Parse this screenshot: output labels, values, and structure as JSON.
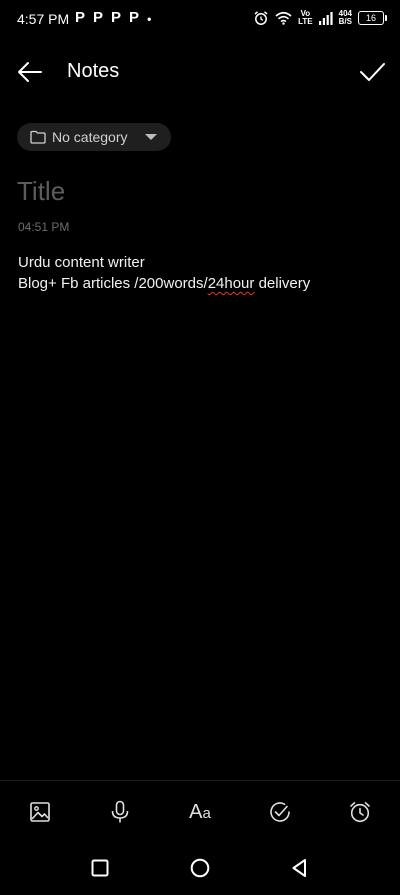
{
  "status_bar": {
    "time": "4:57 PM",
    "notifications": [
      "P",
      "P",
      "P",
      "P"
    ],
    "dot": "•",
    "network_speed_value": "404",
    "network_speed_unit": "B/S",
    "volte_top": "Vo",
    "volte_bottom": "LTE",
    "battery": "16",
    "icons": [
      "alarm-icon",
      "wifi-icon",
      "volte-icon",
      "signal-icon",
      "battery-icon"
    ]
  },
  "header": {
    "title": "Notes",
    "back_icon": "arrow-left-icon",
    "save_icon": "checkmark-icon"
  },
  "category": {
    "label": "No category",
    "icon": "folder-icon"
  },
  "note": {
    "title_placeholder": "Title",
    "time": "04:51 PM",
    "body_line1": "Urdu content writer",
    "body_line2_pre": "Blog+ Fb articles /200words/",
    "body_line2_misspelled": "24hour",
    "body_line2_post": " delivery"
  },
  "toolbar": {
    "format_label_big": "A",
    "format_label_small": "a",
    "icons": [
      "image-icon",
      "microphone-icon",
      "text-format-icon",
      "checklist-icon",
      "alarm-clock-icon"
    ]
  },
  "navbar": {
    "icons": [
      "recents-square-icon",
      "home-circle-icon",
      "back-triangle-icon"
    ]
  },
  "colors": {
    "background": "#000000",
    "chip_background": "#1f1f1f",
    "placeholder": "#5c5c5c",
    "spell_error": "#e2342f"
  }
}
